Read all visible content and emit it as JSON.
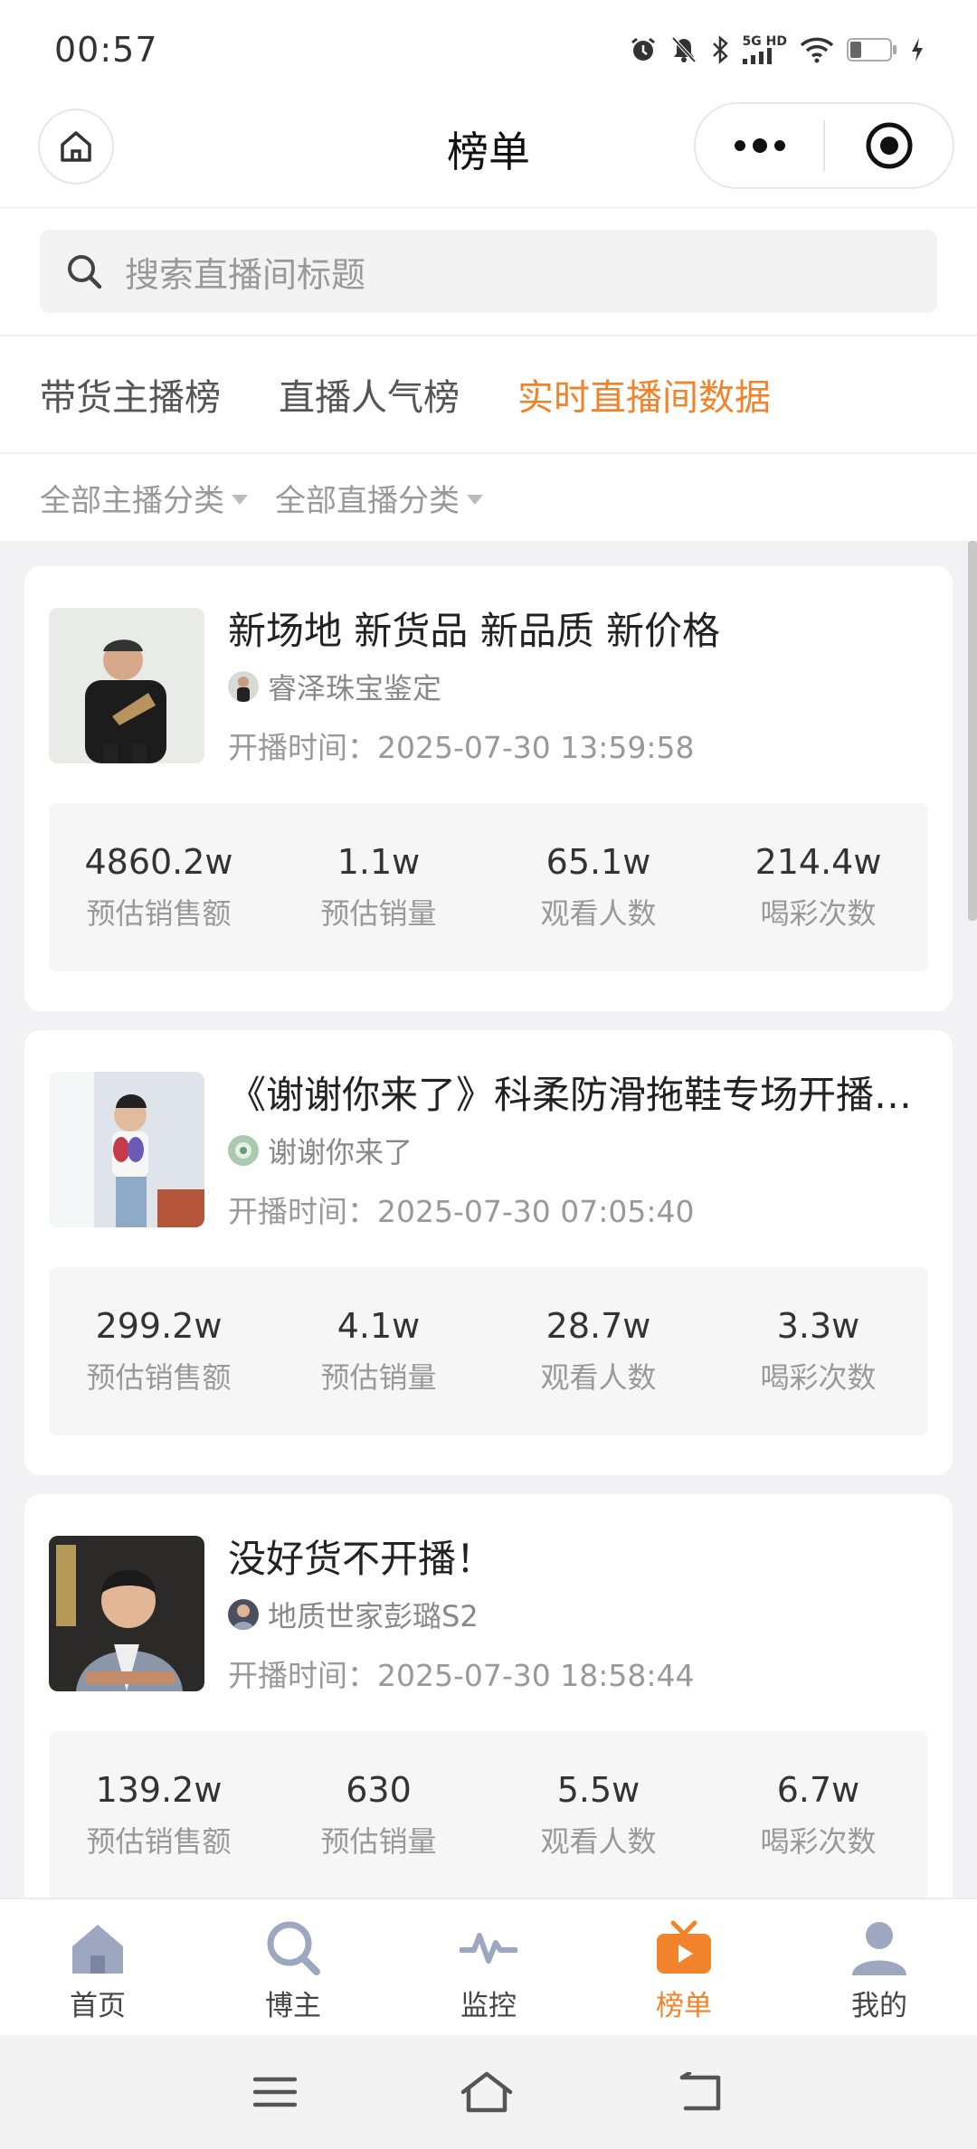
{
  "status_bar": {
    "time": "00:57",
    "network_label": "5G HD"
  },
  "nav": {
    "title": "榜单"
  },
  "search": {
    "placeholder": "搜索直播间标题"
  },
  "tabs": [
    {
      "label": "带货主播榜",
      "active": false
    },
    {
      "label": "直播人气榜",
      "active": false
    },
    {
      "label": "实时直播间数据",
      "active": true
    }
  ],
  "filters": [
    {
      "label": "全部主播分类"
    },
    {
      "label": "全部直播分类"
    }
  ],
  "stat_labels": [
    "预估销售额",
    "预估销量",
    "观看人数",
    "喝彩次数"
  ],
  "cards": [
    {
      "title": "新场地 新货品 新品质 新价格",
      "anchor": "睿泽珠宝鉴定",
      "start_time": "开播时间：2025-07-30 13:59:58",
      "stats": [
        "4860.2w",
        "1.1w",
        "65.1w",
        "214.4w"
      ]
    },
    {
      "title": "《谢谢你来了》科柔防滑拖鞋专场开播…",
      "anchor": "谢谢你来了",
      "start_time": "开播时间：2025-07-30 07:05:40",
      "stats": [
        "299.2w",
        "4.1w",
        "28.7w",
        "3.3w"
      ]
    },
    {
      "title": "没好货不开播！",
      "anchor": "地质世家彭璐S2",
      "start_time": "开播时间：2025-07-30 18:58:44",
      "stats": [
        "139.2w",
        "630",
        "5.5w",
        "6.7w"
      ]
    }
  ],
  "tabbar": [
    {
      "label": "首页",
      "icon": "home-icon",
      "active": false
    },
    {
      "label": "博主",
      "icon": "search-icon",
      "active": false
    },
    {
      "label": "监控",
      "icon": "pulse-icon",
      "active": false
    },
    {
      "label": "榜单",
      "icon": "tv-icon",
      "active": true
    },
    {
      "label": "我的",
      "icon": "user-icon",
      "active": false
    }
  ],
  "colors": {
    "accent": "#f0832b",
    "icon_gray": "#9ea7c0"
  }
}
